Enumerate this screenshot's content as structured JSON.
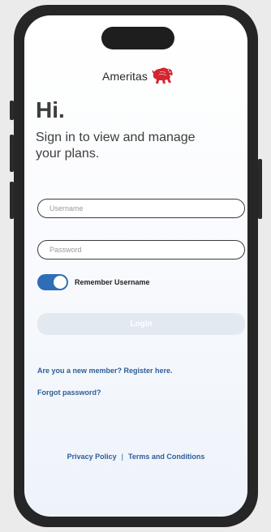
{
  "brand": {
    "name": "Ameritas",
    "logo_icon": "bison-logo-icon",
    "logo_color": "#d22630"
  },
  "login": {
    "greeting": "Hi.",
    "subtitle": "Sign in to view and manage your plans.",
    "username_placeholder": "Username",
    "password_placeholder": "Password",
    "remember_label": "Remember Username",
    "remember_enabled": true,
    "login_button_label": "Login"
  },
  "links": {
    "register": "Are you a new member? Register here.",
    "forgot_password": "Forgot password?"
  },
  "footer": {
    "privacy": "Privacy Policy",
    "separator": "|",
    "terms": "Terms and Conditions"
  },
  "colors": {
    "accent": "#2f6db6",
    "link": "#2f5d99",
    "login_disabled_bg": "#e3e9f0"
  }
}
